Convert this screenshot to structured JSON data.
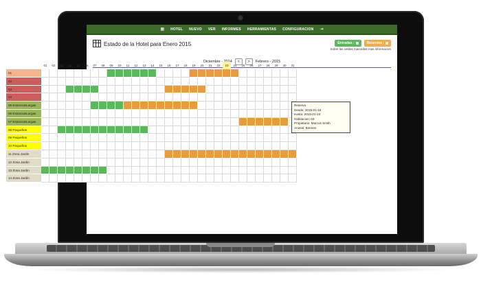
{
  "nav": {
    "items": [
      "HOTEL",
      "NUEVO",
      "VER",
      "INFORMES",
      "HERRAMIENTAS",
      "CONFIGURACION"
    ]
  },
  "header": {
    "title": "Estado de la Hotel para Enero 2015",
    "legend_entries": "Entradas",
    "legend_reserves": "Reserves",
    "hint": "Sobre las celdas marcadas mas informacion"
  },
  "month_nav": {
    "prev_month": "Diciembre - 2014",
    "prev_button": "<",
    "next_button": ">",
    "next_month": "Febrero - 2015"
  },
  "calendar": {
    "days": [
      "01",
      "02",
      "03",
      "04",
      "05",
      "06",
      "07",
      "08",
      "09",
      "10",
      "11",
      "12",
      "13",
      "14",
      "15",
      "16",
      "17",
      "18",
      "19",
      "20",
      "21",
      "22",
      "23",
      "24",
      "25",
      "26",
      "27",
      "28",
      "29",
      "30",
      "31"
    ],
    "today": "23",
    "rooms": [
      {
        "name": "01",
        "color": "#f5b48a",
        "bookings": [
          {
            "type": "green",
            "start": 9,
            "end": 14
          },
          {
            "type": "orange",
            "start": 19,
            "end": 24
          }
        ]
      },
      {
        "name": "02",
        "color": "#cd5c5c",
        "bookings": []
      },
      {
        "name": "03",
        "color": "#cd5c5c",
        "bookings": [
          {
            "type": "green",
            "start": 4,
            "end": 7
          },
          {
            "type": "orange",
            "start": 16,
            "end": 20
          }
        ]
      },
      {
        "name": "04",
        "color": "#cd5c5c",
        "bookings": []
      },
      {
        "name": "05 EstanciasLargas",
        "color": "#9ab85b",
        "bookings": [
          {
            "type": "green",
            "start": 7,
            "end": 10
          },
          {
            "type": "orange",
            "start": 11,
            "end": 19
          }
        ]
      },
      {
        "name": "06 EstanciasLargas",
        "color": "#9ab85b",
        "bookings": []
      },
      {
        "name": "07 EstanciasLargas",
        "color": "#9ab85b",
        "bookings": [
          {
            "type": "orange",
            "start": 25,
            "end": 30
          }
        ]
      },
      {
        "name": "08 Pequeños",
        "color": "#ffff00",
        "bookings": [
          {
            "type": "green",
            "start": 3,
            "end": 13
          }
        ]
      },
      {
        "name": "09 Pequeños",
        "color": "#ffff00",
        "bookings": []
      },
      {
        "name": "10 Pequeños",
        "color": "#ffff00",
        "bookings": []
      },
      {
        "name": "11 Zona Jardin",
        "color": "#e2dbc5",
        "bookings": [
          {
            "type": "orange",
            "start": 16,
            "end": 22
          },
          {
            "type": "orange",
            "start": 23,
            "end": 31
          }
        ]
      },
      {
        "name": "12 Zona Jardin",
        "color": "#e2dbc5",
        "bookings": []
      },
      {
        "name": "13 Zona Jardin",
        "color": "#e2dbc5",
        "bookings": [
          {
            "type": "green",
            "start": 1,
            "end": 8
          }
        ]
      },
      {
        "name": "14 Zona Jardin",
        "color": "#e2dbc5",
        "bookings": []
      }
    ]
  },
  "tooltip": {
    "title": "Reserva",
    "from": "Desde: 2015-01-16",
    "to": "Hasta: 2015-01-23",
    "room": "Habitacion: 03",
    "owner": "Propietario: Marcus Smith",
    "animal": "Animal: Botmen"
  }
}
